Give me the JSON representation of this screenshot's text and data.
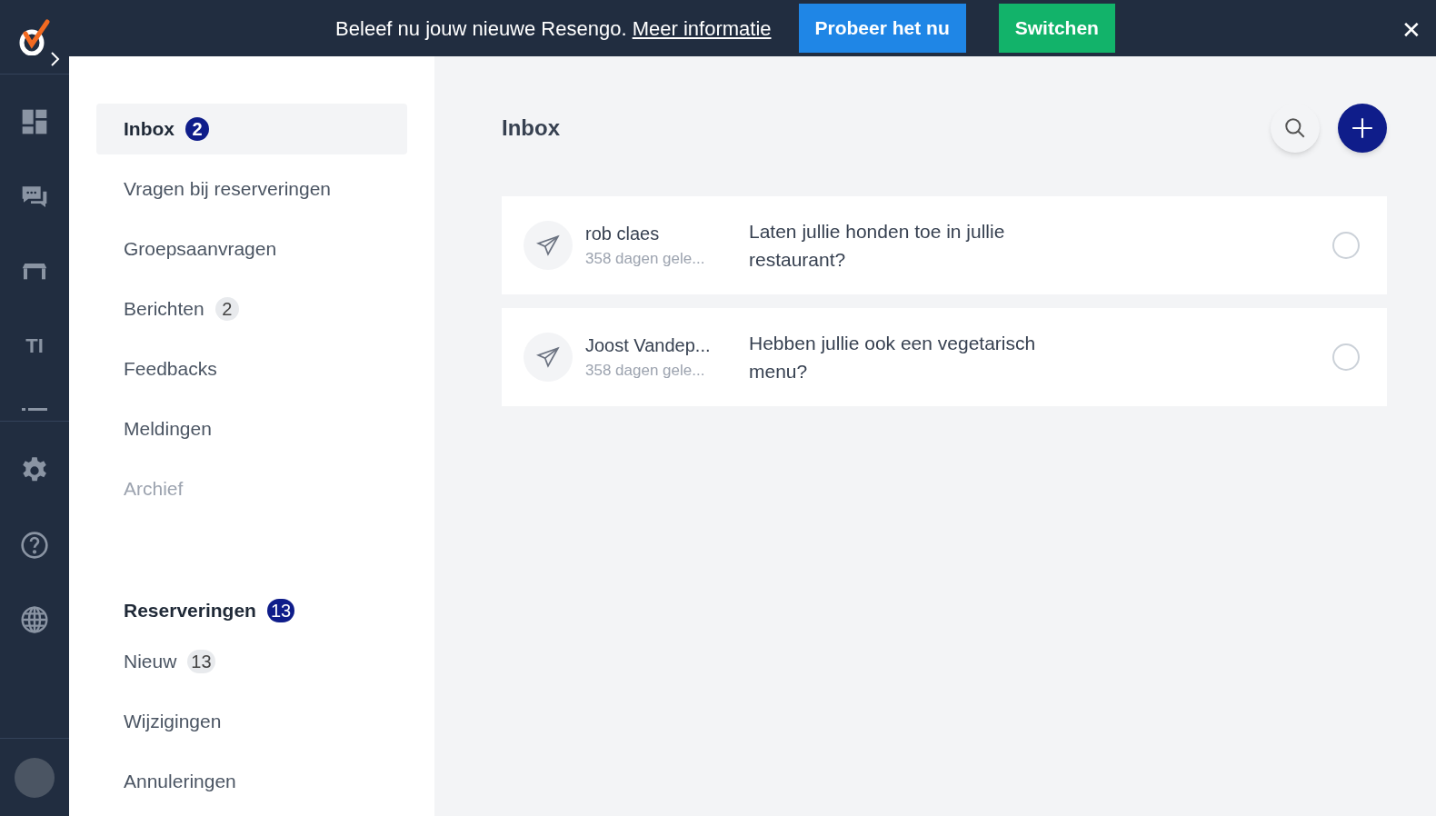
{
  "banner": {
    "text": "Beleef nu jouw nieuwe Resengo.",
    "link": "Meer informatie",
    "buttons": [
      {
        "label": "Probeer het nu",
        "kind": "primary"
      },
      {
        "label": "Switchen",
        "kind": "success"
      }
    ],
    "close": "✕"
  },
  "rail": {
    "items": [
      {
        "kind": "dashboard"
      },
      {
        "kind": "chat"
      },
      {
        "kind": "table"
      },
      {
        "kind": "text",
        "label": "TI"
      },
      {
        "kind": "list"
      },
      {
        "kind": "settings"
      },
      {
        "kind": "help"
      },
      {
        "kind": "globe"
      }
    ]
  },
  "nav": [
    {
      "kind": "item",
      "label": "Inbox",
      "badge": {
        "count": "2",
        "kind": "strong"
      },
      "selected": true,
      "disabled": false
    },
    {
      "kind": "item",
      "label": "Vragen bij reserveringen",
      "selected": false,
      "disabled": false
    },
    {
      "kind": "item",
      "label": "Groepsaanvragen",
      "selected": false,
      "disabled": false
    },
    {
      "kind": "item",
      "label": "Berichten",
      "badge": {
        "count": "2",
        "kind": "soft"
      },
      "selected": false,
      "disabled": false
    },
    {
      "kind": "item",
      "label": "Feedbacks",
      "selected": false,
      "disabled": false
    },
    {
      "kind": "item",
      "label": "Meldingen",
      "selected": false,
      "disabled": false
    },
    {
      "kind": "item",
      "label": "Archief",
      "selected": false,
      "disabled": true
    },
    {
      "kind": "header",
      "label": "Reserveringen",
      "badge": {
        "count": "13",
        "kind": "strong"
      }
    },
    {
      "kind": "item",
      "label": "Nieuw",
      "badge": {
        "count": "13",
        "kind": "soft"
      },
      "selected": false,
      "disabled": false
    },
    {
      "kind": "item",
      "label": "Wijzigingen",
      "selected": false,
      "disabled": false
    },
    {
      "kind": "item",
      "label": "Annuleringen",
      "selected": false,
      "disabled": false
    }
  ],
  "main": {
    "title": "Inbox",
    "messages": [
      {
        "sender": "rob claes",
        "time": "358 dagen gele...",
        "text": "Laten jullie honden toe in jullie restaurant?",
        "checked": false
      },
      {
        "sender": "Joost Vandep...",
        "time": "358 dagen gele...",
        "text": "Hebben jullie ook een vegetarisch menu?",
        "checked": false
      }
    ]
  }
}
